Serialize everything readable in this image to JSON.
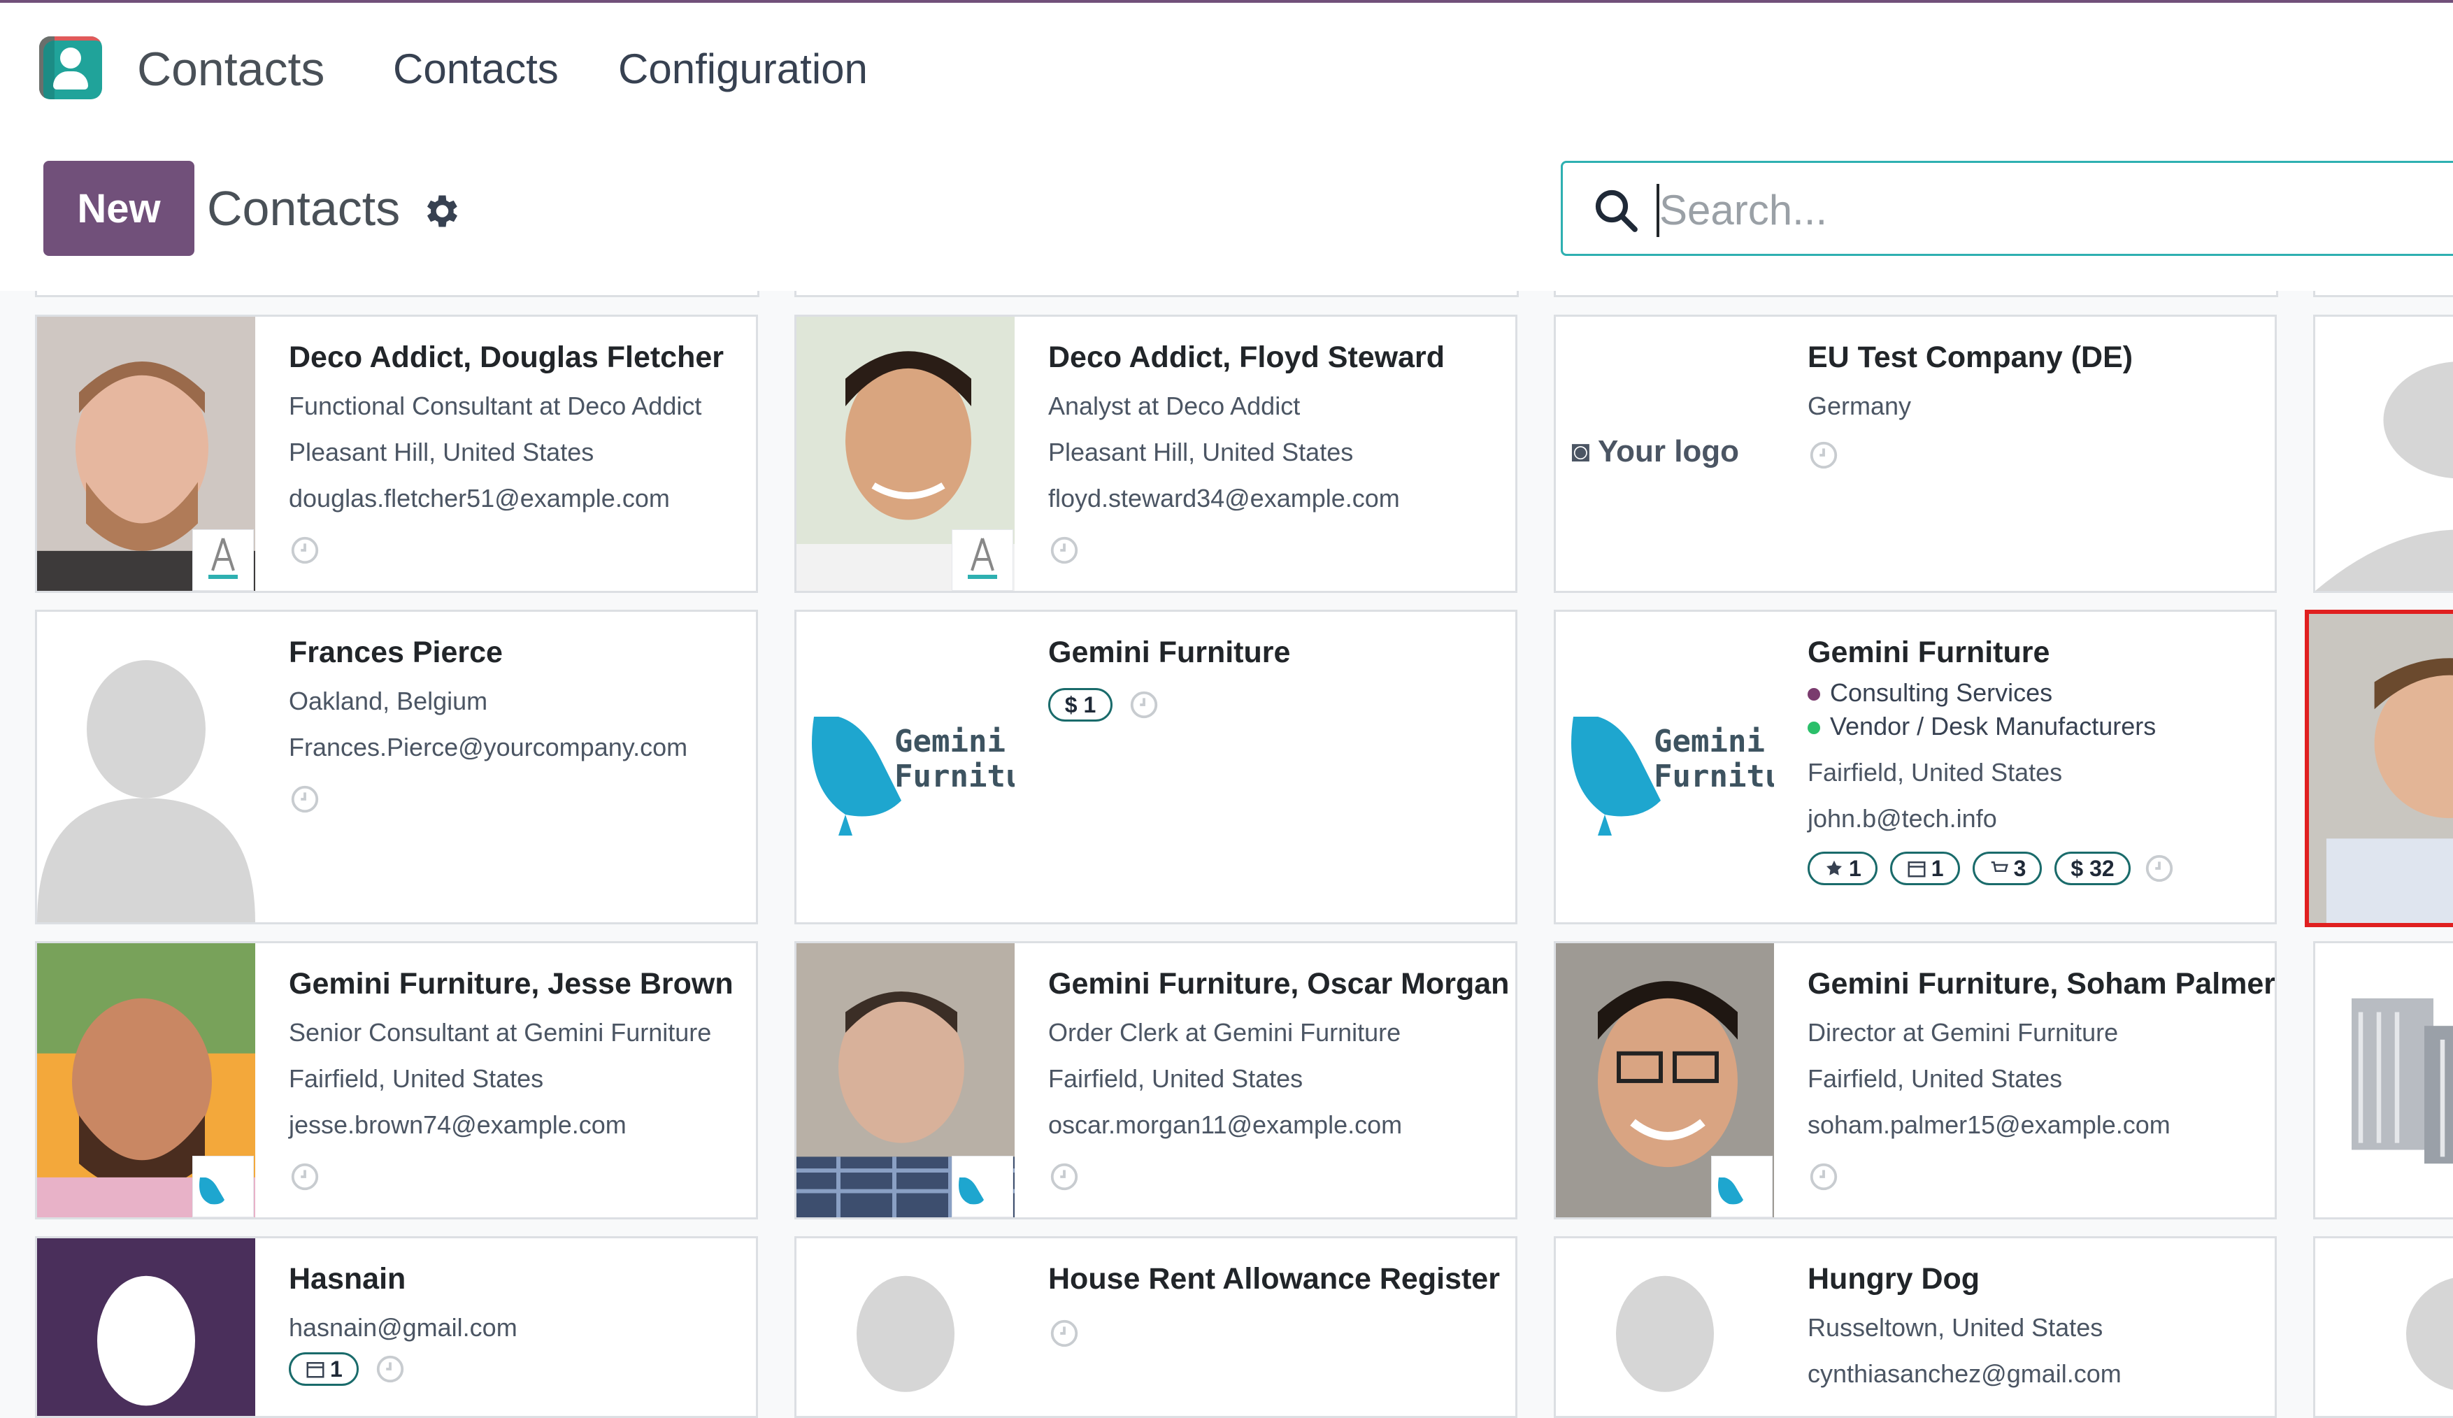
{
  "navbar": {
    "app_name": "Contacts",
    "menu": [
      "Contacts",
      "Configuration"
    ]
  },
  "control": {
    "new_label": "New",
    "title": "Contacts",
    "search_placeholder": "Search..."
  },
  "cards": [
    {
      "name": "Deco Addict, Douglas Fletcher",
      "lines": [
        "Functional Consultant at Deco Addict",
        "Pleasant Hill, United States",
        "douglas.fletcher51@example.com"
      ],
      "company_badge": "Deco Addict"
    },
    {
      "name": "Deco Addict, Floyd Steward",
      "lines": [
        "Analyst at Deco Addict",
        "Pleasant Hill, United States",
        "floyd.steward34@example.com"
      ],
      "company_badge": "Deco Addict"
    },
    {
      "name": "EU Test Company (DE)",
      "lines": [
        "Germany"
      ],
      "image_text": "Your logo"
    },
    {
      "name": "Frances Pierce",
      "lines": [
        "Oakland, Belgium",
        "Frances.Pierce@yourcompany.com"
      ]
    },
    {
      "name": "Gemini Furniture",
      "pills": [
        "$ 1"
      ],
      "image_text": "Gemini Furniture"
    },
    {
      "name": "Gemini Furniture",
      "tags": [
        {
          "label": "Consulting Services",
          "color": "#7a3b6e"
        },
        {
          "label": "Vendor / Desk Manufacturers",
          "color": "#2bbf6a"
        }
      ],
      "lines": [
        "Fairfield, United States",
        "john.b@tech.info"
      ],
      "pills": [
        "1",
        "1",
        "3",
        "$ 32"
      ],
      "image_text": "Gemini Furniture"
    },
    {
      "name": "Gemini Furniture, Jesse Brown",
      "lines": [
        "Senior Consultant at Gemini Furniture",
        "Fairfield, United States",
        "jesse.brown74@example.com"
      ]
    },
    {
      "name": "Gemini Furniture, Oscar Morgan",
      "lines": [
        "Order Clerk at Gemini Furniture",
        "Fairfield, United States",
        "oscar.morgan11@example.com"
      ]
    },
    {
      "name": "Gemini Furniture, Soham Palmer",
      "lines": [
        "Director at Gemini Furniture",
        "Fairfield, United States",
        "soham.palmer15@example.com"
      ]
    },
    {
      "name": "Hasnain",
      "lines": [
        "hasnain@gmail.com"
      ],
      "pills": [
        "1"
      ]
    },
    {
      "name": "House Rent Allowance Register"
    },
    {
      "name": "Hungry Dog",
      "lines": [
        "Russeltown, United States",
        "cynthiasanchez@gmail.com"
      ]
    }
  ],
  "colors": {
    "brand": "#71507a",
    "accent": "#2eb0b1",
    "selected_border": "#e02020"
  }
}
